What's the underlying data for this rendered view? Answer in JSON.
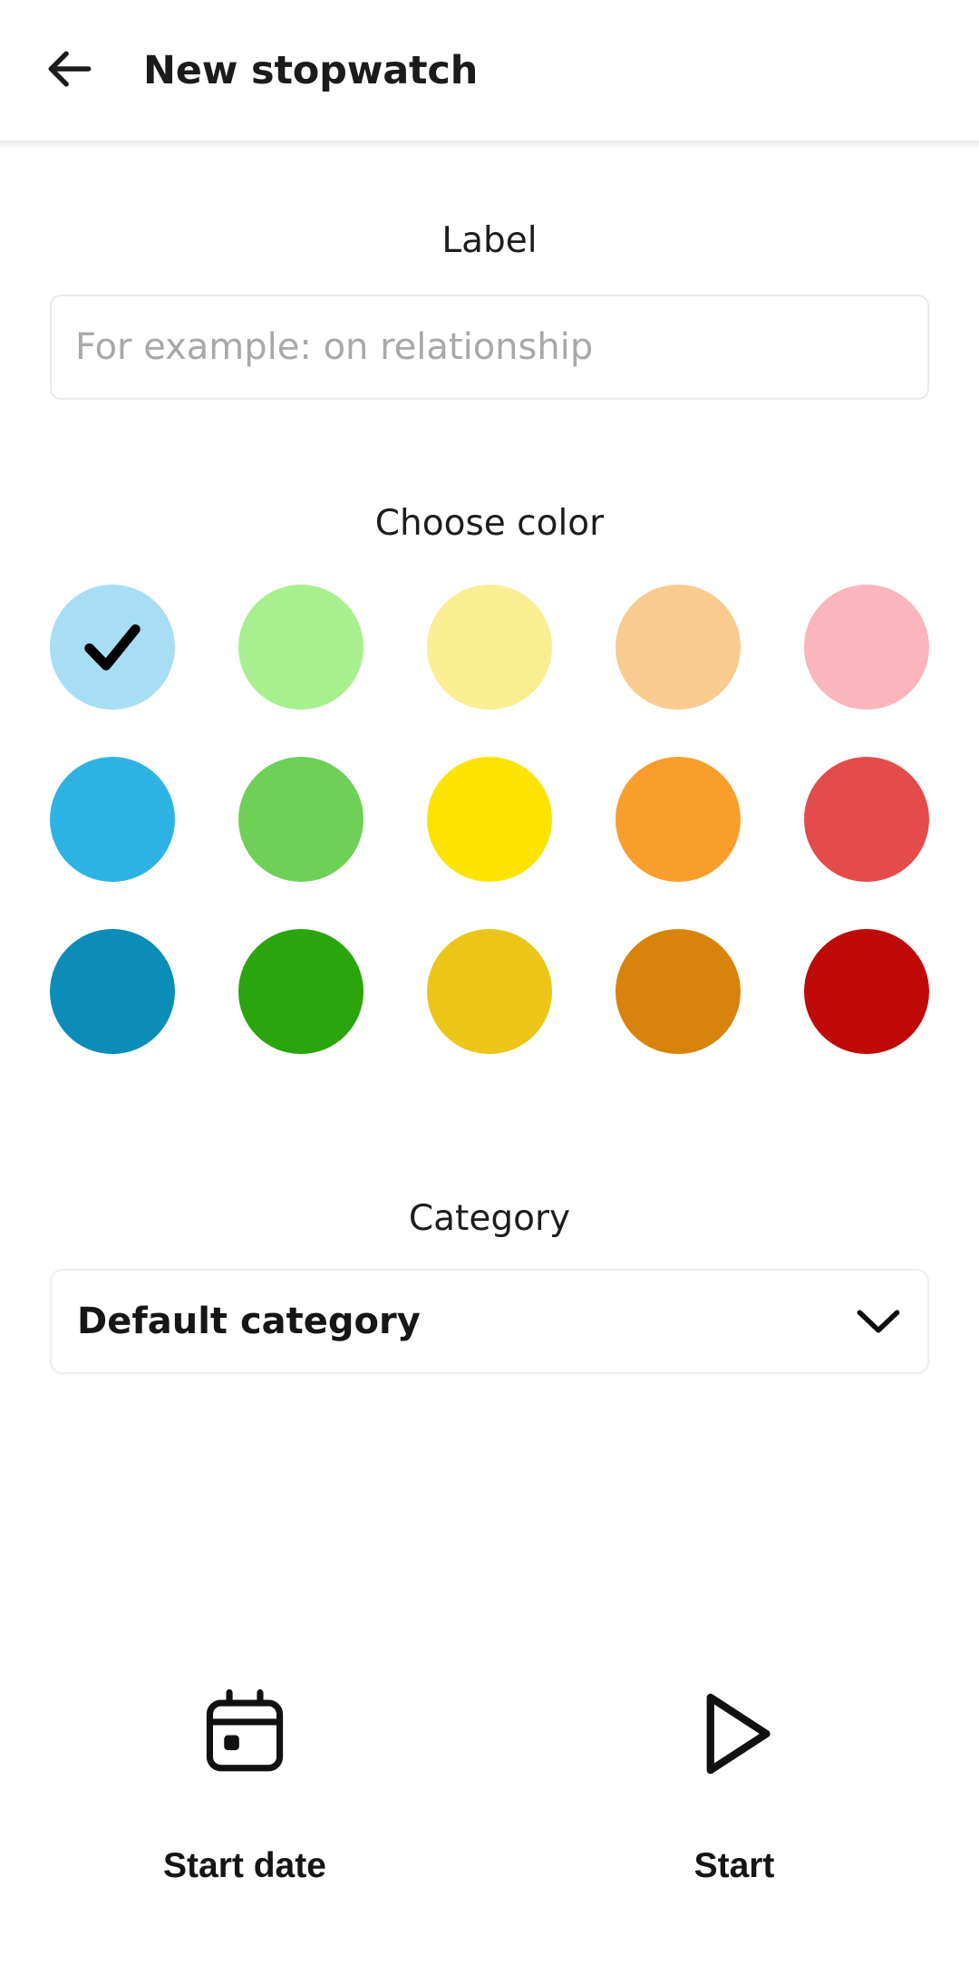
{
  "appbar": {
    "back_icon": "arrow-left-icon",
    "title": "New stopwatch"
  },
  "label_section": {
    "heading": "Label",
    "input_value": "",
    "input_placeholder": "For example: on relationship"
  },
  "color_section": {
    "heading": "Choose color",
    "selected_index": 0,
    "check_icon": "check-icon",
    "rows": [
      [
        {
          "name": "light-blue",
          "hex": "#A7DEF4",
          "selected": true
        },
        {
          "name": "light-green",
          "hex": "#A8F08E",
          "selected": false
        },
        {
          "name": "light-yellow",
          "hex": "#F9EE92",
          "selected": false
        },
        {
          "name": "light-orange",
          "hex": "#F9CB8F",
          "selected": false
        },
        {
          "name": "light-pink",
          "hex": "#FBB5BC",
          "selected": false
        }
      ],
      [
        {
          "name": "blue",
          "hex": "#2CB3E4",
          "selected": false
        },
        {
          "name": "green",
          "hex": "#6ED056",
          "selected": false
        },
        {
          "name": "yellow",
          "hex": "#FCE300",
          "selected": false
        },
        {
          "name": "orange",
          "hex": "#F99D2B",
          "selected": false
        },
        {
          "name": "red",
          "hex": "#E44B4B",
          "selected": false
        }
      ],
      [
        {
          "name": "dark-blue",
          "hex": "#0C8DB8",
          "selected": false
        },
        {
          "name": "dark-green",
          "hex": "#2AA50D",
          "selected": false
        },
        {
          "name": "dark-yellow",
          "hex": "#EBC518",
          "selected": false
        },
        {
          "name": "dark-orange",
          "hex": "#D8830C",
          "selected": false
        },
        {
          "name": "dark-red",
          "hex": "#C00A0A",
          "selected": false
        }
      ]
    ]
  },
  "category_section": {
    "heading": "Category",
    "selected_value": "Default category",
    "chevron_icon": "chevron-down-icon"
  },
  "actions": [
    {
      "name": "start-date",
      "icon": "calendar-icon",
      "label": "Start date"
    },
    {
      "name": "start",
      "icon": "play-icon",
      "label": "Start"
    }
  ],
  "colors": {
    "text": "#161616",
    "placeholder": "#A8A8A8",
    "border": "#E9E9E9",
    "background": "#FFFFFF"
  }
}
